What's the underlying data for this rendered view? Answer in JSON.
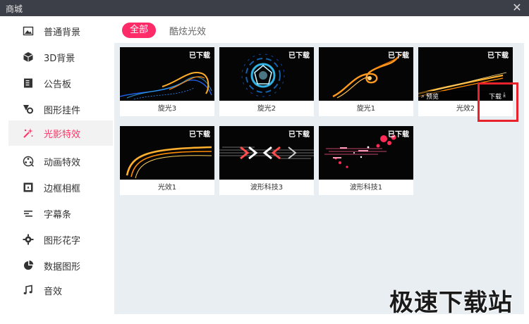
{
  "window": {
    "title": "商城",
    "close_glyph": "✕"
  },
  "sidebar": {
    "items": [
      {
        "label": "普通背景",
        "icon": "image-icon",
        "active": false
      },
      {
        "label": "3D背景",
        "icon": "cube-icon",
        "active": false
      },
      {
        "label": "公告板",
        "icon": "board-icon",
        "active": false
      },
      {
        "label": "图形挂件",
        "icon": "shapes-icon",
        "active": false
      },
      {
        "label": "光影特效",
        "icon": "sparkle-icon",
        "active": true
      },
      {
        "label": "动画特效",
        "icon": "film-reel-icon",
        "active": false
      },
      {
        "label": "边框相框",
        "icon": "frame-icon",
        "active": false
      },
      {
        "label": "字幕条",
        "icon": "subtitle-bar-icon",
        "active": false
      },
      {
        "label": "图形花字",
        "icon": "gear-flower-icon",
        "active": false
      },
      {
        "label": "数据图形",
        "icon": "pie-chart-icon",
        "active": false
      },
      {
        "label": "音效",
        "icon": "music-note-icon",
        "active": false
      }
    ],
    "active_color": "#ff3366"
  },
  "tabs": {
    "all": "全部",
    "cool": "酷炫光效"
  },
  "cards": [
    {
      "name": "旋光3",
      "badge": "已下载"
    },
    {
      "name": "旋光2",
      "badge": "已下载"
    },
    {
      "name": "旋光1",
      "badge": "已下载"
    },
    {
      "name": "光效2",
      "badge": "已下载",
      "preview": "预览",
      "download": "下载",
      "download_glyph": "⤓"
    },
    {
      "name": "光效1",
      "badge": "已下载"
    },
    {
      "name": "波形科技3",
      "badge": "已下载"
    },
    {
      "name": "波形科技1",
      "badge": "已下载"
    }
  ],
  "watermark": "极速下载站"
}
